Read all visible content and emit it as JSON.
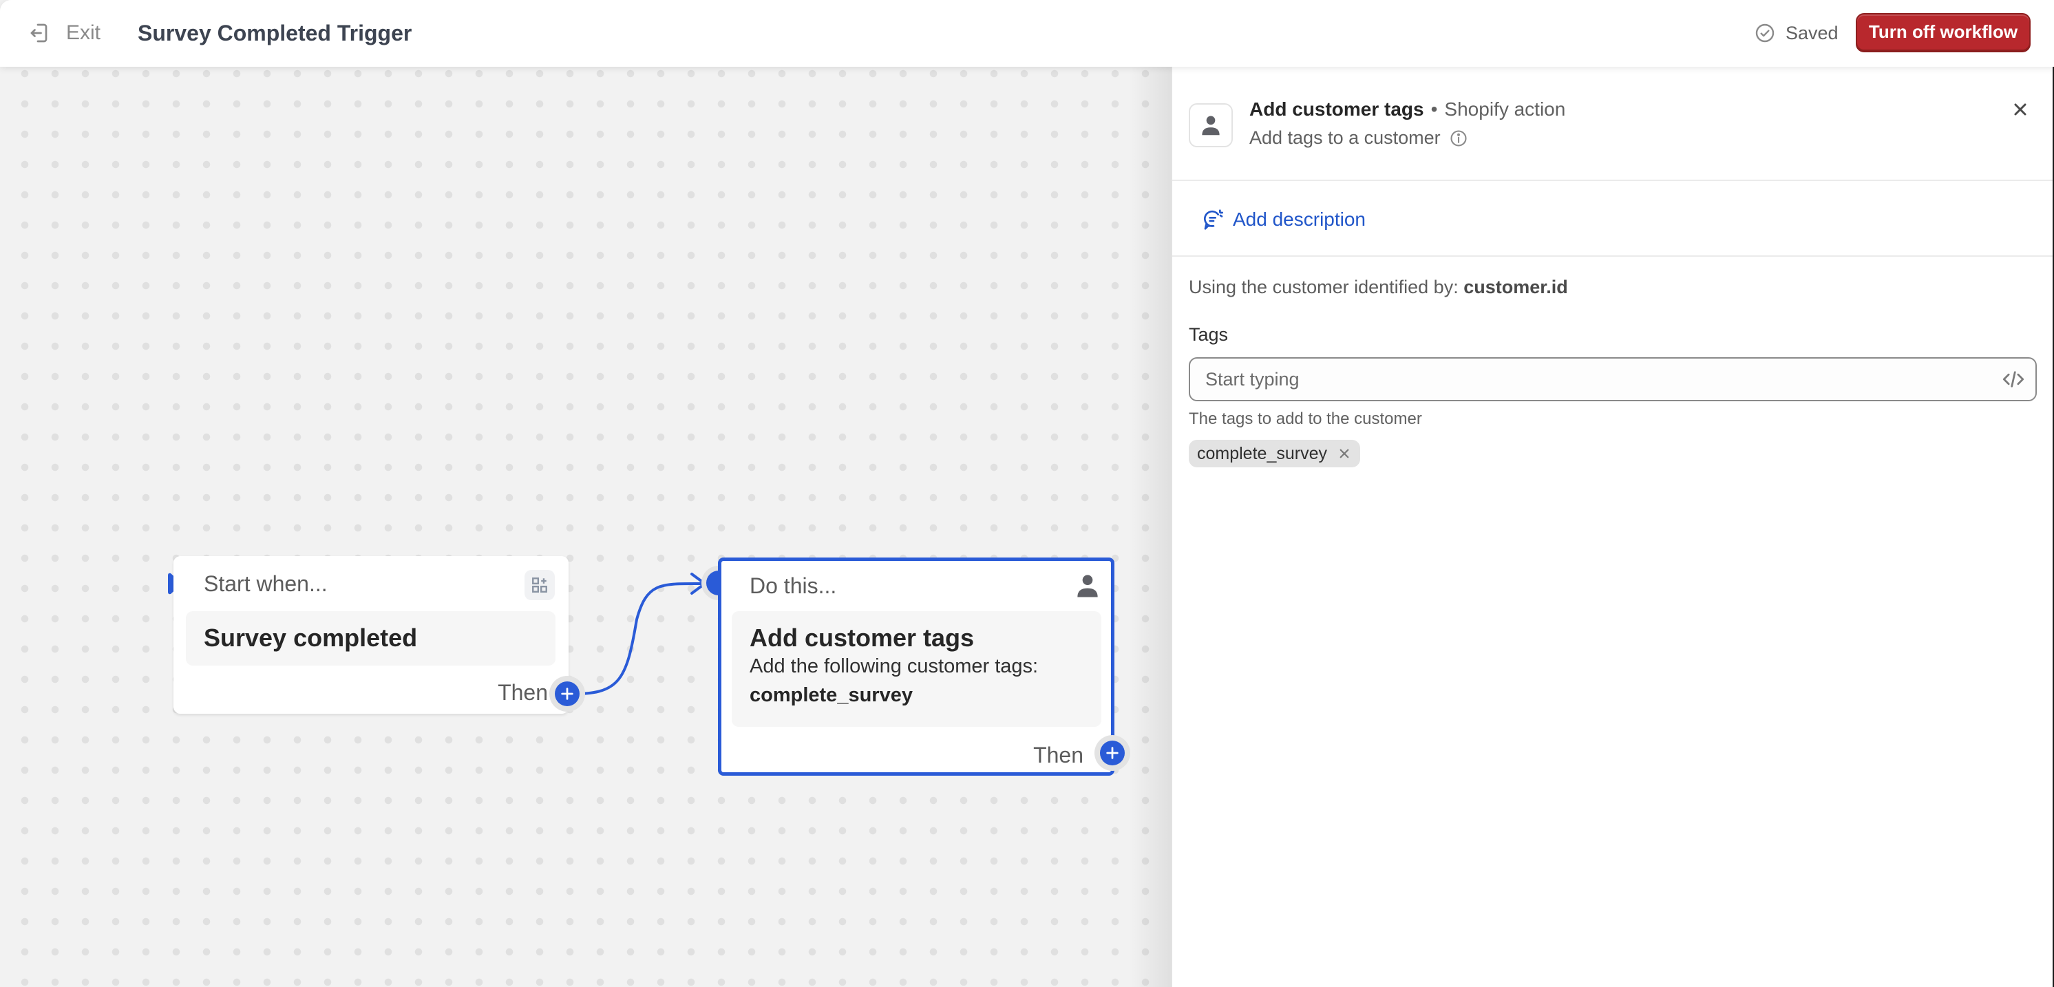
{
  "header": {
    "exit_label": "Exit",
    "workflow_title": "Survey Completed Trigger",
    "status_label": "Saved",
    "turn_off_label": "Turn off workflow"
  },
  "canvas": {
    "trigger_card": {
      "heading": "Start when...",
      "title": "Survey completed",
      "then_label": "Then"
    },
    "action_card": {
      "heading": "Do this...",
      "title": "Add customer tags",
      "description": "Add the following customer tags:",
      "tag": "complete_survey",
      "then_label": "Then"
    }
  },
  "panel": {
    "title": "Add customer tags",
    "separator": "•",
    "kind": "Shopify action",
    "subtitle": "Add tags to a customer",
    "add_description_label": "Add description",
    "using_prefix": "Using the customer identified by:",
    "using_value": "customer.id",
    "tags_label": "Tags",
    "tags_placeholder": "Start typing",
    "tags_value": "",
    "tags_help": "The tags to add to the customer",
    "tags": [
      "complete_survey"
    ]
  },
  "colors": {
    "accent": "#2a5bd7",
    "danger": "#b8282d",
    "link": "#2156c9"
  }
}
